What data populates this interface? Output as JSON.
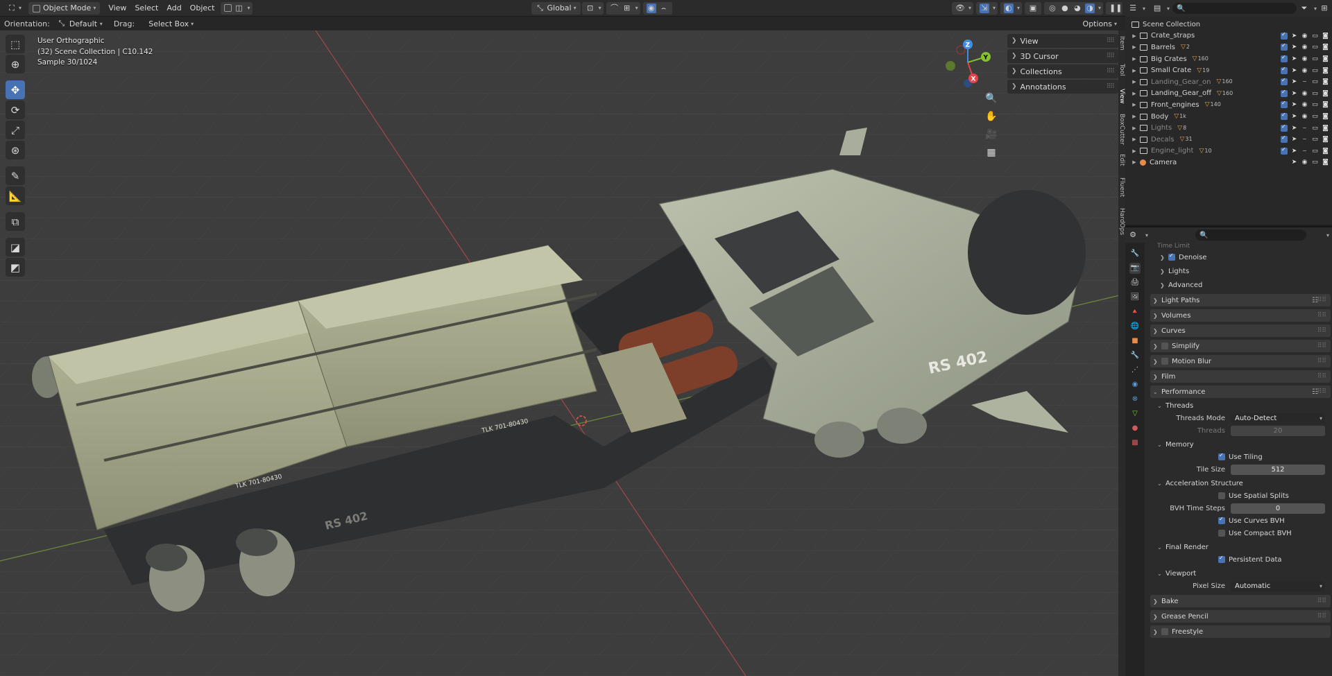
{
  "header": {
    "editor_icon": "viewport-editor-icon",
    "mode": "Object Mode",
    "menus": [
      "View",
      "Select",
      "Add",
      "Object"
    ],
    "transform_orientation": "Global"
  },
  "tool_header": {
    "orientation_label": "Orientation:",
    "orientation_value": "Default",
    "drag_label": "Drag:",
    "drag_value": "Select Box",
    "options_label": "Options"
  },
  "overlay": {
    "view_name": "User Orthographic",
    "collection_info": "(32) Scene Collection | C10.142",
    "sample": "Sample 30/1024"
  },
  "npanel": {
    "items": [
      "View",
      "3D Cursor",
      "Collections",
      "Annotations"
    ],
    "tabs": [
      "Item",
      "Tool",
      "View",
      "BoxCutter",
      "Edit",
      "Fluent",
      "HardOps"
    ]
  },
  "gizmo": {
    "x": "X",
    "y": "Y",
    "z": "Z"
  },
  "model_decals": {
    "hull_text": "RS 402",
    "crate_text_1": "TLK 701-80430",
    "crate_text_2": "TLK 701-80430"
  },
  "outliner": {
    "root": "Scene Collection",
    "rows": [
      {
        "name": "Crate_straps",
        "badge": "",
        "dim": false
      },
      {
        "name": "Barrels",
        "badge": "2",
        "dim": false
      },
      {
        "name": "Big Crates",
        "badge": "160",
        "dim": false
      },
      {
        "name": "Small Crate",
        "badge": "19",
        "dim": false
      },
      {
        "name": "Landing_Gear_on",
        "badge": "160",
        "dim": true
      },
      {
        "name": "Landing_Gear_off",
        "badge": "160",
        "dim": false
      },
      {
        "name": "Front_engines",
        "badge": "140",
        "dim": false
      },
      {
        "name": "Body",
        "badge": "1k",
        "dim": false
      },
      {
        "name": "Lights",
        "badge": "8",
        "dim": true
      },
      {
        "name": "Decals",
        "badge": "31",
        "dim": true
      },
      {
        "name": "Engine_light",
        "badge": "10",
        "dim": true
      },
      {
        "name": "Camera",
        "badge": "",
        "dim": false
      }
    ]
  },
  "properties": {
    "partial_top": "Time Limit",
    "denoise": "Denoise",
    "lights": "Lights",
    "advanced": "Advanced",
    "light_paths": "Light Paths",
    "volumes": "Volumes",
    "curves": "Curves",
    "simplify": "Simplify",
    "motion_blur": "Motion Blur",
    "film": "Film",
    "performance": "Performance",
    "threads": "Threads",
    "threads_mode_label": "Threads Mode",
    "threads_mode_value": "Auto-Detect",
    "threads_label": "Threads",
    "threads_value": "20",
    "memory": "Memory",
    "use_tiling": "Use Tiling",
    "tile_size_label": "Tile Size",
    "tile_size_value": "512",
    "accel": "Acceleration Structure",
    "use_spatial_splits": "Use Spatial Splits",
    "bvh_steps_label": "BVH Time Steps",
    "bvh_steps_value": "0",
    "use_curves_bvh": "Use Curves BVH",
    "use_compact_bvh": "Use Compact BVH",
    "final_render": "Final Render",
    "persistent_data": "Persistent Data",
    "viewport": "Viewport",
    "pixel_size_label": "Pixel Size",
    "pixel_size_value": "Automatic",
    "bake": "Bake",
    "grease_pencil": "Grease Pencil",
    "freestyle": "Freestyle"
  },
  "colors": {
    "accent": "#4772b3",
    "x_axis": "#e3444b",
    "y_axis": "#85c22c",
    "z_axis": "#3f8ee4",
    "hull": "#aeb39f",
    "crates": "#a8a98b"
  }
}
